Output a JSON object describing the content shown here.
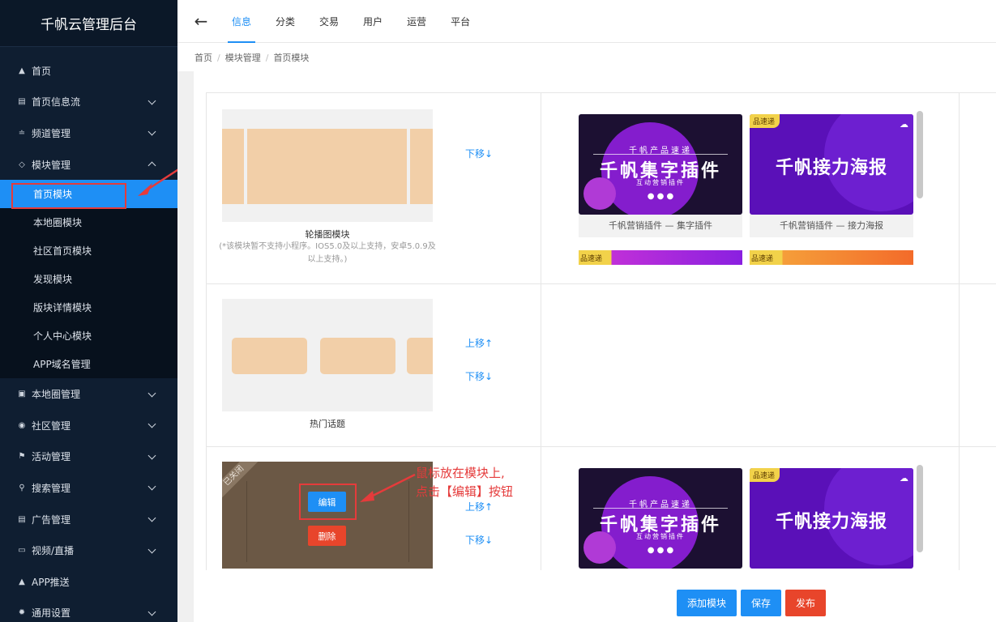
{
  "sidebar": {
    "title": "千帆云管理后台",
    "items": [
      {
        "icon": "home-icon",
        "label": "首页"
      },
      {
        "icon": "feed-icon",
        "label": "首页信息流"
      },
      {
        "icon": "rss-icon",
        "label": "频道管理"
      },
      {
        "icon": "module-icon",
        "label": "模块管理"
      },
      {
        "icon": "map-icon",
        "label": "本地圈管理"
      },
      {
        "icon": "community-icon",
        "label": "社区管理"
      },
      {
        "icon": "activity-icon",
        "label": "活动管理"
      },
      {
        "icon": "search-icon",
        "label": "搜索管理"
      },
      {
        "icon": "ad-icon",
        "label": "广告管理"
      },
      {
        "icon": "video-icon",
        "label": "视频/直播"
      },
      {
        "icon": "bell-icon",
        "label": "APP推送"
      },
      {
        "icon": "gear-icon",
        "label": "通用设置"
      }
    ],
    "sub_items": [
      {
        "label": "首页模块"
      },
      {
        "label": "本地圈模块"
      },
      {
        "label": "社区首页模块"
      },
      {
        "label": "发现模块"
      },
      {
        "label": "版块详情模块"
      },
      {
        "label": "个人中心模块"
      },
      {
        "label": "APP域名管理"
      }
    ]
  },
  "topnav": {
    "tabs": [
      {
        "label": "信息"
      },
      {
        "label": "分类"
      },
      {
        "label": "交易"
      },
      {
        "label": "用户"
      },
      {
        "label": "运营"
      },
      {
        "label": "平台"
      }
    ]
  },
  "breadcrumb": [
    "首页",
    "模块管理",
    "首页模块"
  ],
  "modules": [
    {
      "name": "轮播图模块",
      "note": "(*该模块暂不支持小程序。IOS5.0及以上支持，安卓5.0.9及以上支持。)",
      "move_down": "下移↓"
    },
    {
      "name": "热门话题",
      "move_up": "上移↑",
      "move_down": "下移↓"
    },
    {
      "status": "已关闭",
      "edit_label": "编辑",
      "delete_label": "删除",
      "move_up": "上移↑",
      "move_down": "下移↓"
    }
  ],
  "banners": {
    "tag": "品速递",
    "dark_top": "千帆产品速递",
    "dark_main": "千帆集字插件",
    "dark_sub": "互动营销插件",
    "purple_main": "千帆接力海报",
    "caption1": "千帆营销插件 — 集字插件",
    "caption2": "千帆营销插件 — 接力海报"
  },
  "annotation": {
    "line1": "鼠标放在模块上,",
    "line2": "点击【编辑】按钮"
  },
  "footer": {
    "add_label": "添加模块",
    "save_label": "保存",
    "publish_label": "发布"
  },
  "colors": {
    "sidebar_bg": "#0f1e31",
    "accent": "#1e8ff5",
    "danger": "#e8452b",
    "annotation_red": "#e53b3b"
  }
}
